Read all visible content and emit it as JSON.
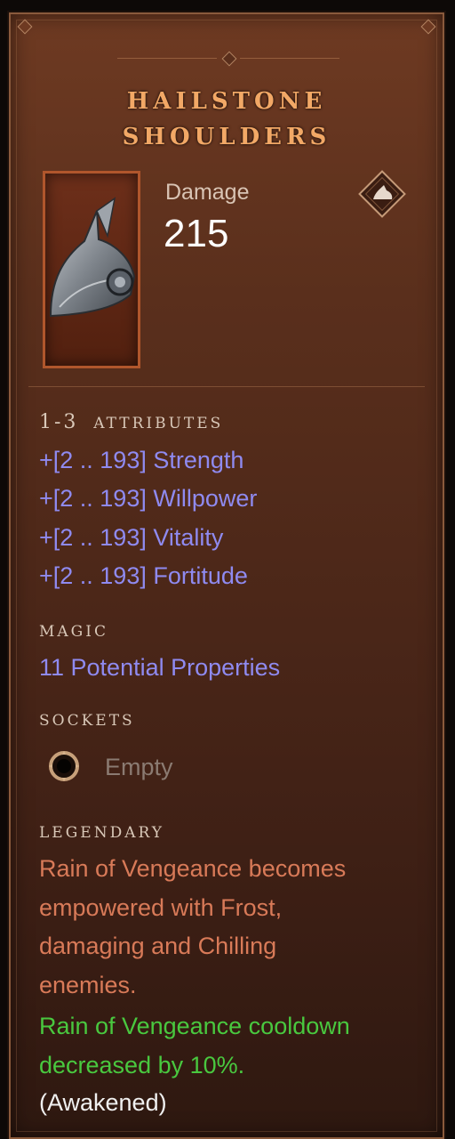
{
  "item": {
    "title_line1": "HAILSTONE",
    "title_line2": "SHOULDERS",
    "icon": "pauldron-armor-icon"
  },
  "stat": {
    "label": "Damage",
    "value": "215",
    "slot_icon": "shoulders-slot-icon"
  },
  "attributes": {
    "heading_count": "1-3",
    "heading": "ATTRIBUTES",
    "lines": [
      "+[2 .. 193] Strength",
      "+[2 .. 193] Willpower",
      "+[2 .. 193] Vitality",
      "+[2 .. 193] Fortitude"
    ]
  },
  "magic": {
    "heading": "MAGIC",
    "text": "11 Potential Properties"
  },
  "sockets": {
    "heading": "SOCKETS",
    "slot_text": "Empty",
    "icon": "empty-socket-icon"
  },
  "legendary": {
    "heading": "LEGENDARY",
    "effect_lines": [
      "Rain of Vengeance becomes",
      "empowered with Frost,",
      "damaging and Chilling",
      "enemies."
    ],
    "bonus_lines": [
      "Rain of Vengeance cooldown",
      "decreased by 10%."
    ],
    "status": "(Awakened)"
  },
  "colors": {
    "title": "#f2a866",
    "attribute_blue": "#8f8af0",
    "legendary_red": "#d87a58",
    "bonus_green": "#49c83f",
    "icon_border": "#b0562c"
  }
}
